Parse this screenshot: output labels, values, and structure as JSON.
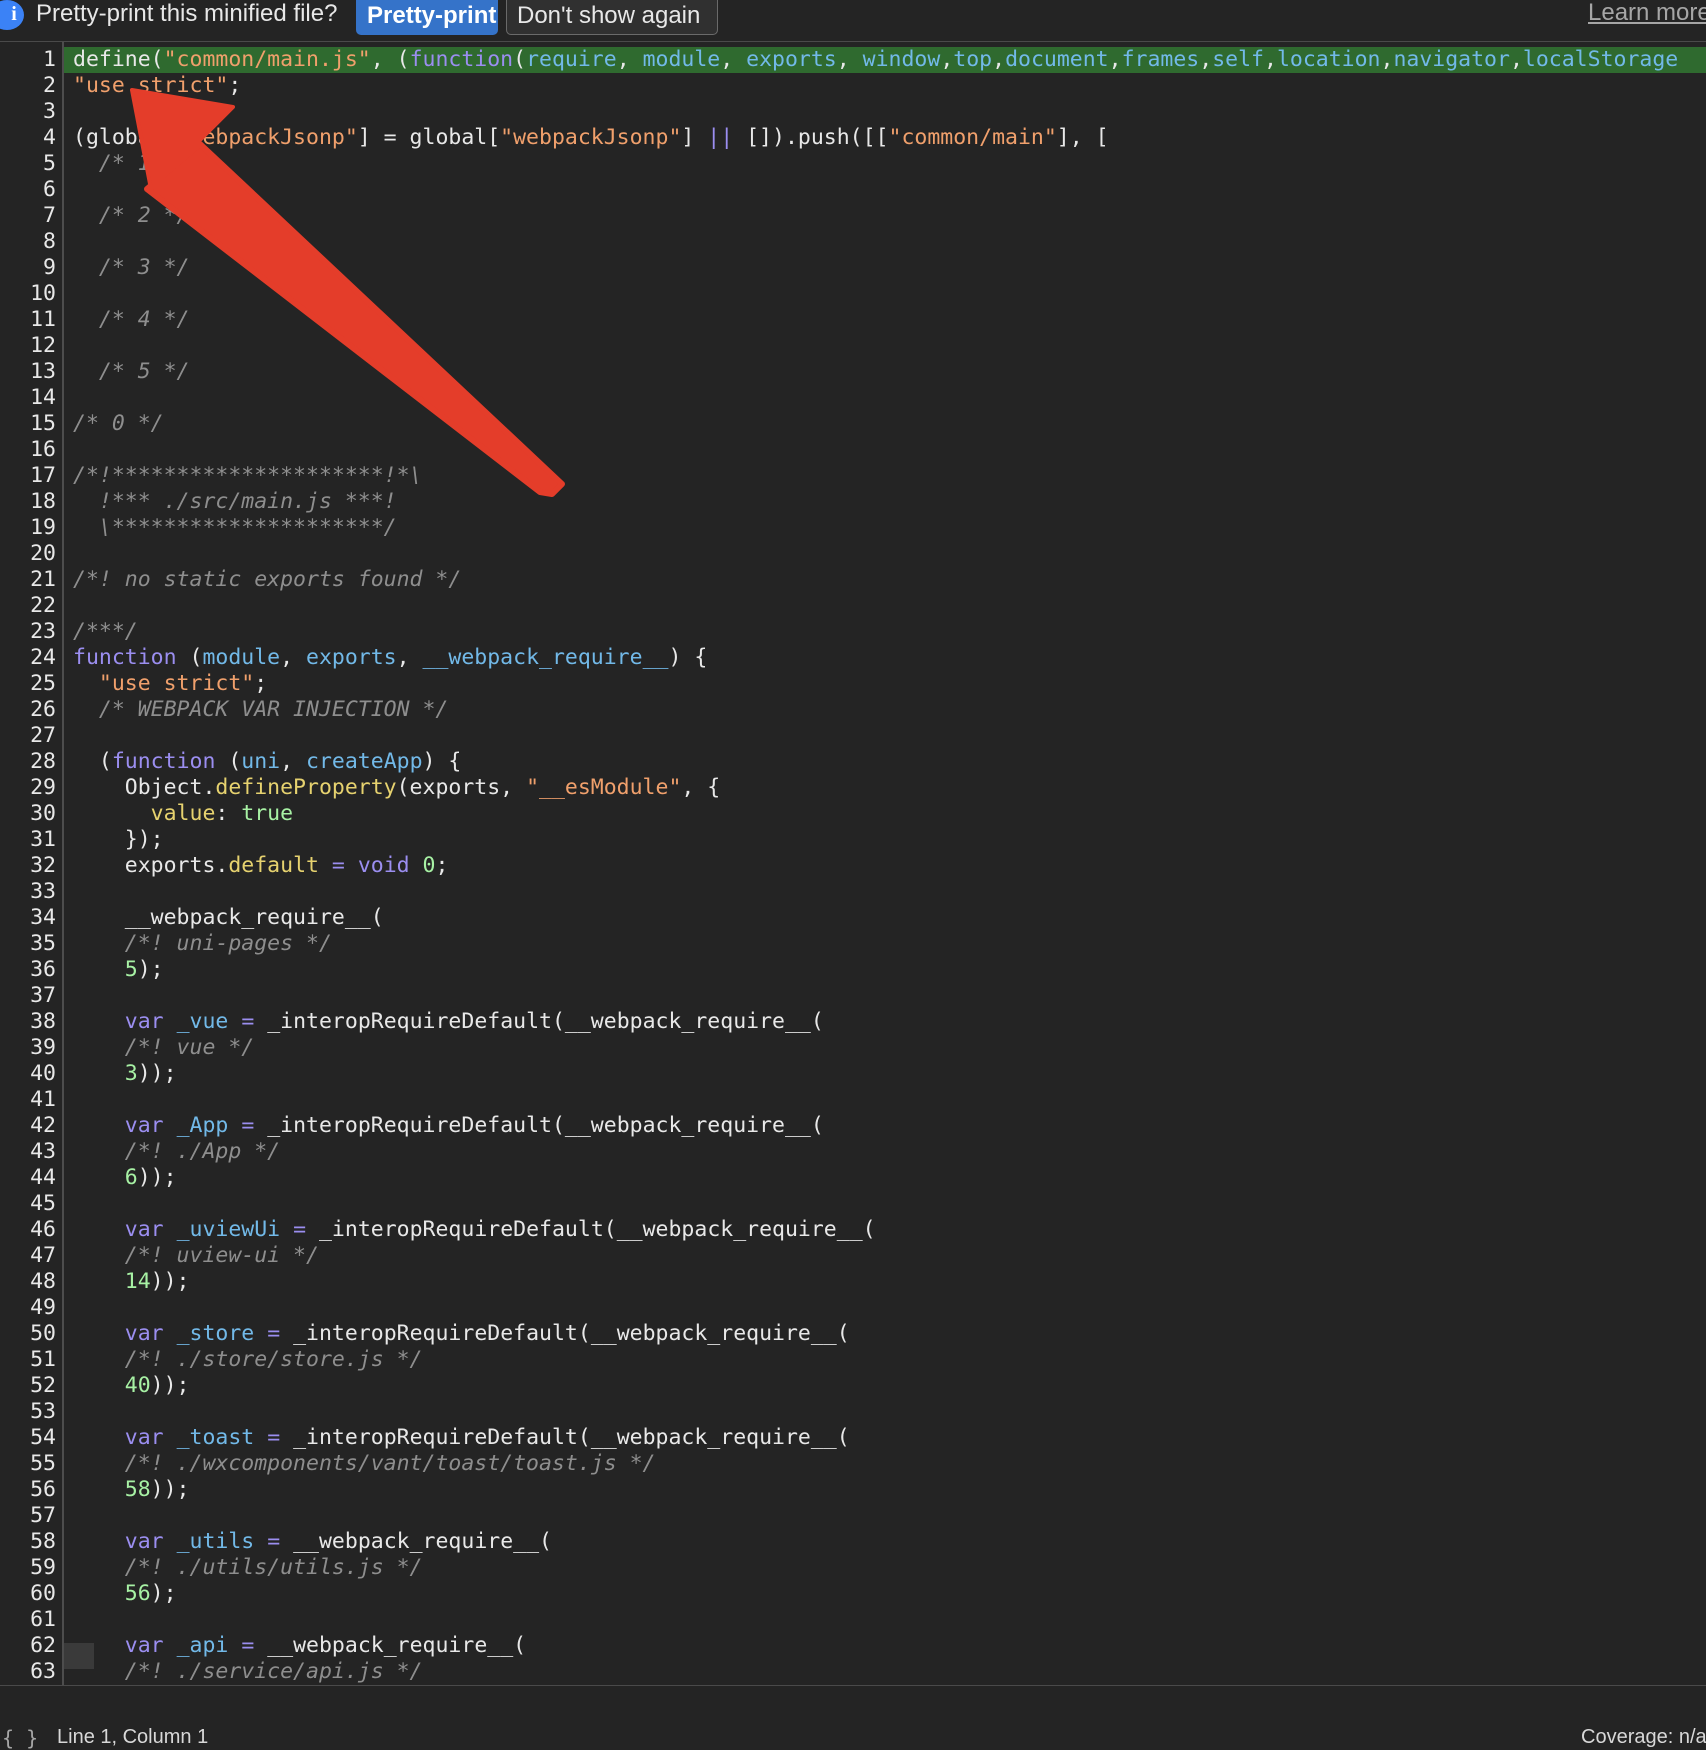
{
  "infobar": {
    "message": "Pretty-print this minified file?",
    "pretty_print_button": "Pretty-print",
    "dont_show_button": "Don't show again",
    "learn_more_link": "Learn more",
    "info_icon": "info-icon"
  },
  "statusbar": {
    "icon": "{ }",
    "position": "Line 1, Column 1",
    "coverage": "Coverage: n/a"
  },
  "colors": {
    "background": "#242424",
    "highlight_line": "#2f6a2f",
    "keyword": "#9b8ef0",
    "string": "#f0a06c",
    "variable": "#72b9e8",
    "number": "#a7f1a4",
    "comment": "#8e8e8e",
    "button_primary": "#3573c9",
    "annotation_arrow": "#e43d2a"
  },
  "editor": {
    "highlighted_line": 1,
    "lines": [
      [
        [
          "p",
          "define("
        ],
        [
          "s",
          "\"common/main.js\""
        ],
        [
          "p",
          ", ("
        ],
        [
          "k",
          "function"
        ],
        [
          "p",
          "("
        ],
        [
          "v",
          "require"
        ],
        [
          "p",
          ", "
        ],
        [
          "v",
          "module"
        ],
        [
          "p",
          ", "
        ],
        [
          "v",
          "exports"
        ],
        [
          "p",
          ", "
        ],
        [
          "v",
          "window"
        ],
        [
          "p",
          ","
        ],
        [
          "v",
          "top"
        ],
        [
          "p",
          ","
        ],
        [
          "v",
          "document"
        ],
        [
          "p",
          ","
        ],
        [
          "v",
          "frames"
        ],
        [
          "p",
          ","
        ],
        [
          "v",
          "self"
        ],
        [
          "p",
          ","
        ],
        [
          "v",
          "location"
        ],
        [
          "p",
          ","
        ],
        [
          "v",
          "navigator"
        ],
        [
          "p",
          ","
        ],
        [
          "v",
          "localStorage"
        ]
      ],
      [
        [
          "s",
          "\"use strict\""
        ],
        [
          "p",
          ";"
        ]
      ],
      [],
      [
        [
          "p",
          "(global["
        ],
        [
          "s",
          "\"webpackJsonp\""
        ],
        [
          "p",
          "] = global["
        ],
        [
          "s",
          "\"webpackJsonp\""
        ],
        [
          "p",
          "] "
        ],
        [
          "k",
          "||"
        ],
        [
          "p",
          " []).push([["
        ],
        [
          "s",
          "\"common/main\""
        ],
        [
          "p",
          "], ["
        ]
      ],
      [
        [
          "c",
          "  /* 1 */"
        ]
      ],
      [],
      [
        [
          "c",
          "  /* 2 */"
        ]
      ],
      [],
      [
        [
          "c",
          "  /* 3 */"
        ]
      ],
      [],
      [
        [
          "c",
          "  /* 4 */"
        ]
      ],
      [],
      [
        [
          "c",
          "  /* 5 */"
        ]
      ],
      [],
      [
        [
          "c",
          "/* 0 */"
        ]
      ],
      [],
      [
        [
          "c",
          "/*!*********************!*\\"
        ]
      ],
      [
        [
          "c",
          "  !*** ./src/main.js ***!"
        ]
      ],
      [
        [
          "c",
          "  \\*********************/"
        ]
      ],
      [],
      [
        [
          "c",
          "/*! no static exports found */"
        ]
      ],
      [],
      [
        [
          "c",
          "/***/"
        ]
      ],
      [
        [
          "k",
          "function"
        ],
        [
          "p",
          " ("
        ],
        [
          "v",
          "module"
        ],
        [
          "p",
          ", "
        ],
        [
          "v",
          "exports"
        ],
        [
          "p",
          ", "
        ],
        [
          "v",
          "__webpack_require__"
        ],
        [
          "p",
          ") {"
        ]
      ],
      [
        [
          "p",
          "  "
        ],
        [
          "s",
          "\"use strict\""
        ],
        [
          "p",
          ";"
        ]
      ],
      [
        [
          "c",
          "  /* WEBPACK VAR INJECTION */"
        ]
      ],
      [],
      [
        [
          "p",
          "  ("
        ],
        [
          "k",
          "function"
        ],
        [
          "p",
          " ("
        ],
        [
          "v",
          "uni"
        ],
        [
          "p",
          ", "
        ],
        [
          "v",
          "createApp"
        ],
        [
          "p",
          ") {"
        ]
      ],
      [
        [
          "p",
          "    Object."
        ],
        [
          "f",
          "defineProperty"
        ],
        [
          "p",
          "(exports, "
        ],
        [
          "s",
          "\"__esModule\""
        ],
        [
          "p",
          ", {"
        ]
      ],
      [
        [
          "p",
          "      "
        ],
        [
          "f",
          "value"
        ],
        [
          "p",
          ": "
        ],
        [
          "n",
          "true"
        ]
      ],
      [
        [
          "p",
          "    });"
        ]
      ],
      [
        [
          "p",
          "    exports."
        ],
        [
          "f",
          "default"
        ],
        [
          "p",
          " "
        ],
        [
          "k",
          "="
        ],
        [
          "p",
          " "
        ],
        [
          "k",
          "void"
        ],
        [
          "p",
          " "
        ],
        [
          "n",
          "0"
        ],
        [
          "p",
          ";"
        ]
      ],
      [],
      [
        [
          "p",
          "    __webpack_require__("
        ]
      ],
      [
        [
          "c",
          "    /*! uni-pages */"
        ]
      ],
      [
        [
          "p",
          "    "
        ],
        [
          "n",
          "5"
        ],
        [
          "p",
          ");"
        ]
      ],
      [],
      [
        [
          "p",
          "    "
        ],
        [
          "k",
          "var"
        ],
        [
          "p",
          " "
        ],
        [
          "v",
          "_vue"
        ],
        [
          "p",
          " "
        ],
        [
          "k",
          "="
        ],
        [
          "p",
          " _interopRequireDefault(__webpack_require__("
        ]
      ],
      [
        [
          "c",
          "    /*! vue */"
        ]
      ],
      [
        [
          "p",
          "    "
        ],
        [
          "n",
          "3"
        ],
        [
          "p",
          "));"
        ]
      ],
      [],
      [
        [
          "p",
          "    "
        ],
        [
          "k",
          "var"
        ],
        [
          "p",
          " "
        ],
        [
          "v",
          "_App"
        ],
        [
          "p",
          " "
        ],
        [
          "k",
          "="
        ],
        [
          "p",
          " _interopRequireDefault(__webpack_require__("
        ]
      ],
      [
        [
          "c",
          "    /*! ./App */"
        ]
      ],
      [
        [
          "p",
          "    "
        ],
        [
          "n",
          "6"
        ],
        [
          "p",
          "));"
        ]
      ],
      [],
      [
        [
          "p",
          "    "
        ],
        [
          "k",
          "var"
        ],
        [
          "p",
          " "
        ],
        [
          "v",
          "_uviewUi"
        ],
        [
          "p",
          " "
        ],
        [
          "k",
          "="
        ],
        [
          "p",
          " _interopRequireDefault(__webpack_require__("
        ]
      ],
      [
        [
          "c",
          "    /*! uview-ui */"
        ]
      ],
      [
        [
          "p",
          "    "
        ],
        [
          "n",
          "14"
        ],
        [
          "p",
          "));"
        ]
      ],
      [],
      [
        [
          "p",
          "    "
        ],
        [
          "k",
          "var"
        ],
        [
          "p",
          " "
        ],
        [
          "v",
          "_store"
        ],
        [
          "p",
          " "
        ],
        [
          "k",
          "="
        ],
        [
          "p",
          " _interopRequireDefault(__webpack_require__("
        ]
      ],
      [
        [
          "c",
          "    /*! ./store/store.js */"
        ]
      ],
      [
        [
          "p",
          "    "
        ],
        [
          "n",
          "40"
        ],
        [
          "p",
          "));"
        ]
      ],
      [],
      [
        [
          "p",
          "    "
        ],
        [
          "k",
          "var"
        ],
        [
          "p",
          " "
        ],
        [
          "v",
          "_toast"
        ],
        [
          "p",
          " "
        ],
        [
          "k",
          "="
        ],
        [
          "p",
          " _interopRequireDefault(__webpack_require__("
        ]
      ],
      [
        [
          "c",
          "    /*! ./wxcomponents/vant/toast/toast.js */"
        ]
      ],
      [
        [
          "p",
          "    "
        ],
        [
          "n",
          "58"
        ],
        [
          "p",
          "));"
        ]
      ],
      [],
      [
        [
          "p",
          "    "
        ],
        [
          "k",
          "var"
        ],
        [
          "p",
          " "
        ],
        [
          "v",
          "_utils"
        ],
        [
          "p",
          " "
        ],
        [
          "k",
          "="
        ],
        [
          "p",
          " __webpack_require__("
        ]
      ],
      [
        [
          "c",
          "    /*! ./utils/utils.js */"
        ]
      ],
      [
        [
          "p",
          "    "
        ],
        [
          "n",
          "56"
        ],
        [
          "p",
          ");"
        ]
      ],
      [],
      [
        [
          "p",
          "    "
        ],
        [
          "k",
          "var"
        ],
        [
          "p",
          " "
        ],
        [
          "v",
          "_api"
        ],
        [
          "p",
          " "
        ],
        [
          "k",
          "="
        ],
        [
          "p",
          " __webpack_require__("
        ]
      ],
      [
        [
          "c",
          "    /*! ./service/api.js */"
        ]
      ],
      []
    ]
  }
}
